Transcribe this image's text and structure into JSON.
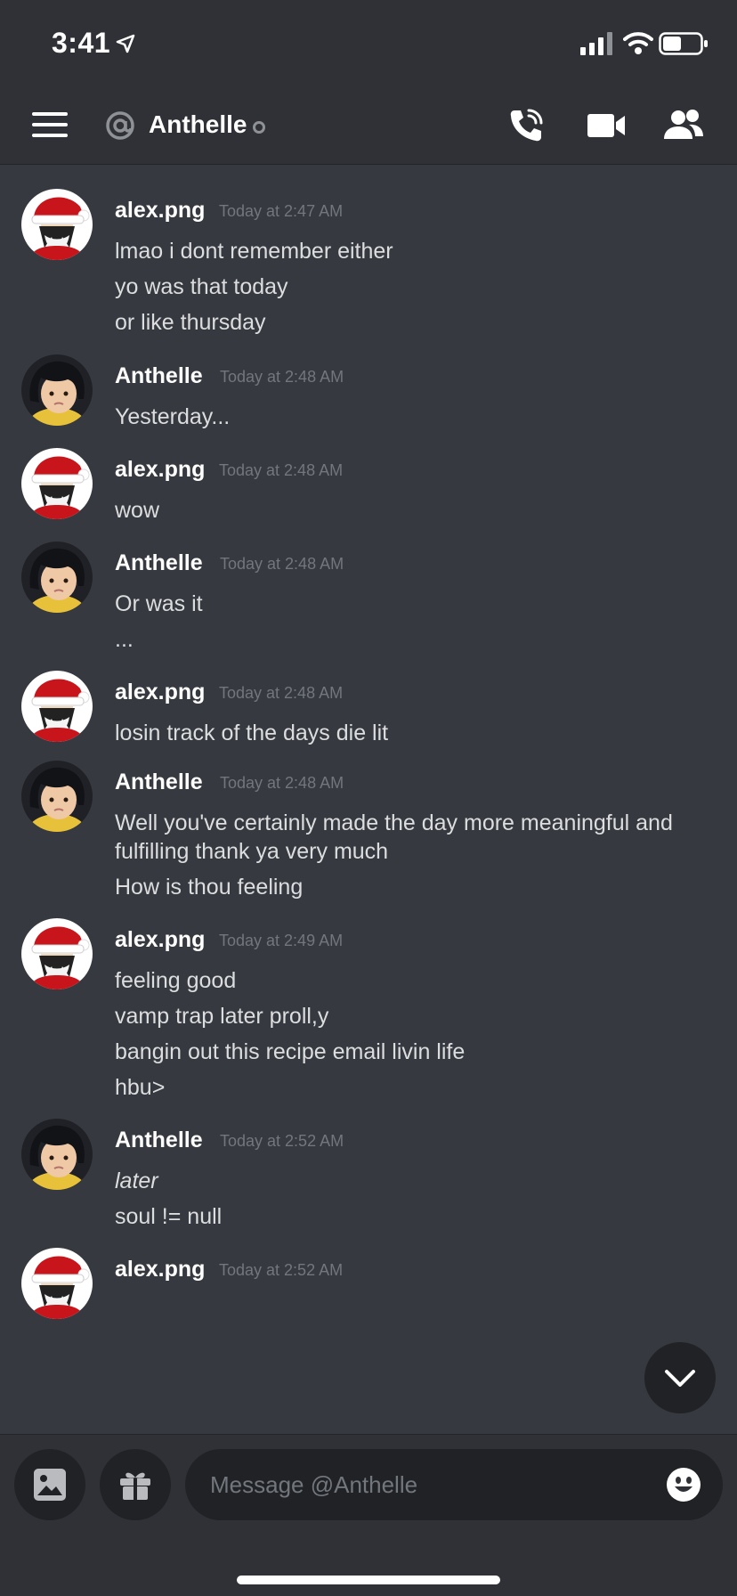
{
  "status_bar": {
    "time": "3:41"
  },
  "header": {
    "channel_name": "Anthelle",
    "icons": [
      "menu-icon",
      "at-icon",
      "call-icon",
      "video-icon",
      "members-icon"
    ]
  },
  "messages": [
    {
      "author": "alex.png",
      "timestamp": "Today at 2:47 AM",
      "lines": [
        "lmao i dont remember either",
        "yo was that today",
        "or like thursday"
      ]
    },
    {
      "author": "Anthelle",
      "timestamp": "Today at 2:48 AM",
      "lines": [
        "Yesterday..."
      ]
    },
    {
      "author": "alex.png",
      "timestamp": "Today at 2:48 AM",
      "lines": [
        "wow"
      ]
    },
    {
      "author": "Anthelle",
      "timestamp": "Today at 2:48 AM",
      "lines": [
        "Or was it",
        "..."
      ]
    },
    {
      "author": "alex.png",
      "timestamp": "Today at 2:48 AM",
      "lines": [
        "losin track of the days die lit"
      ]
    },
    {
      "author": "Anthelle",
      "timestamp": "Today at 2:48 AM",
      "lines": [
        "Well you've certainly made the day more meaningful and",
        "fulfilling thank ya very much",
        "How is thou feeling"
      ]
    },
    {
      "author": "alex.png",
      "timestamp": "Today at 2:49 AM",
      "lines": [
        "feeling good",
        "vamp trap later proll,y",
        "bangin out this recipe email livin life",
        "hbu>"
      ]
    },
    {
      "author": "Anthelle",
      "timestamp": "Today at 2:52 AM",
      "lines": [
        "later",
        "soul != null"
      ]
    },
    {
      "author": "alex.png",
      "timestamp": "Today at 2:52 AM",
      "lines": []
    }
  ],
  "composer": {
    "placeholder": "Message @Anthelle"
  },
  "colors": {
    "background": "#36393f",
    "header": "#2f3136",
    "input": "#202225",
    "text": "#dcddde",
    "muted": "#72767d"
  }
}
